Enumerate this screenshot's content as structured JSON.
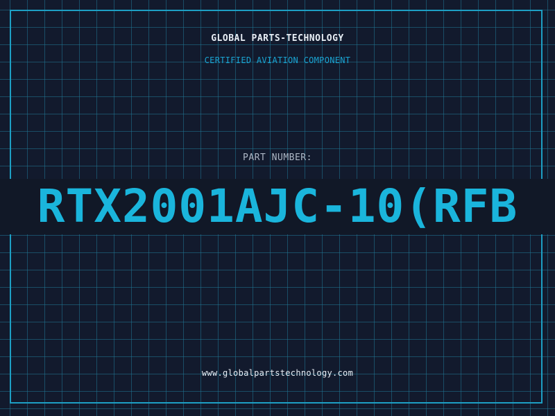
{
  "company": "GLOBAL PARTS-TECHNOLOGY",
  "subtitle": "CERTIFIED AVIATION COMPONENT",
  "part_number_label": "PART NUMBER:",
  "part_number": "RTX2001AJC-10(RFB",
  "website": "www.globalpartstechnology.com",
  "colors": {
    "background": "#121a2d",
    "grid": "#207696",
    "accent": "#1ab5dc",
    "text": "#e8eef5"
  }
}
